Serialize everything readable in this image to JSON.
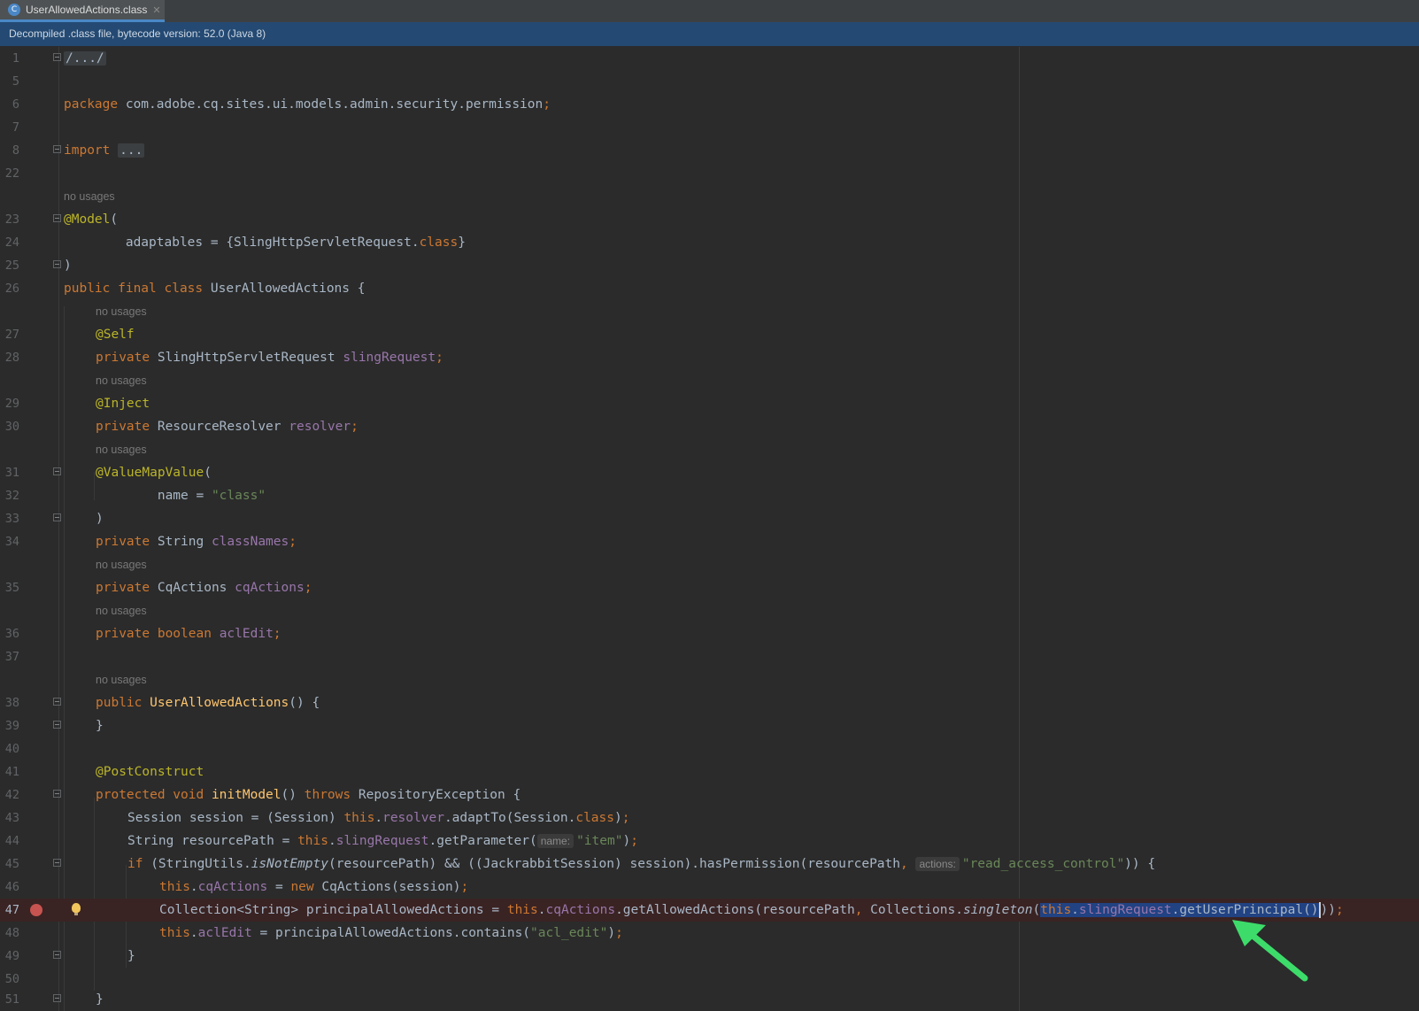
{
  "tab": {
    "title": "UserAllowedActions.class",
    "icon": "class-file-icon",
    "close_icon": "close-icon"
  },
  "banner": {
    "text": "Decompiled .class file, bytecode version: 52.0 (Java 8)"
  },
  "hints": {
    "no_usages": "no usages",
    "name": "name:",
    "actions": "actions:"
  },
  "lines": {
    "1": "1",
    "5": "5",
    "6": "6",
    "7": "7",
    "8": "8",
    "22": "22",
    "23": "23",
    "24": "24",
    "25": "25",
    "26": "26",
    "27": "27",
    "28": "28",
    "29": "29",
    "30": "30",
    "31": "31",
    "32": "32",
    "33": "33",
    "34": "34",
    "35": "35",
    "36": "36",
    "37": "37",
    "38": "38",
    "39": "39",
    "40": "40",
    "41": "41",
    "42": "42",
    "43": "43",
    "44": "44",
    "45": "45",
    "46": "46",
    "47": "47",
    "48": "48",
    "49": "49",
    "50": "50",
    "51": "51"
  },
  "code": {
    "l1": "/.../",
    "l6": {
      "kw": "package",
      "rest": " com.adobe.cq.sites.ui.models.admin.security.permission",
      "semi": ";"
    },
    "l8": {
      "kw": "import",
      "folded": "..."
    },
    "l23": {
      "ann": "@Model",
      "rest": "("
    },
    "l24": {
      "pre": "        adaptables = {SlingHttpServletRequest.",
      "kw": "class",
      "post": "}"
    },
    "l25": ")",
    "l26": {
      "kw": "public final class",
      "rest": " UserAllowedActions {"
    },
    "l27": "@Self",
    "l28": {
      "kw": "private",
      "type": " SlingHttpServletRequest ",
      "field": "slingRequest",
      "semi": ";"
    },
    "l29": "@Inject",
    "l30": {
      "kw": "private",
      "type": " ResourceResolver ",
      "field": "resolver",
      "semi": ";"
    },
    "l31": {
      "ann": "@ValueMapValue",
      "rest": "("
    },
    "l32": {
      "pre": "        name = ",
      "str": "\"class\""
    },
    "l33": ")",
    "l34": {
      "kw": "private",
      "type": " String ",
      "field": "classNames",
      "semi": ";"
    },
    "l35": {
      "kw": "private",
      "type": " CqActions ",
      "field": "cqActions",
      "semi": ";"
    },
    "l36": {
      "kw": "private boolean",
      "type": " ",
      "field": "aclEdit",
      "semi": ";"
    },
    "l38": {
      "kw": "public",
      "fn": "UserAllowedActions",
      "rest": "() {"
    },
    "l39": "}",
    "l41": "@PostConstruct",
    "l42": {
      "kw1": "protected void",
      "fn": "initModel",
      "mid": "() ",
      "kw2": "throws",
      "rest": " RepositoryException {"
    },
    "l43": {
      "pre": "Session session = (Session) ",
      "this": "this",
      "dot": ".",
      "field": "resolver",
      "mid": ".adaptTo(Session.",
      "kw": "class",
      "post": ")",
      "semi": ";"
    },
    "l44": {
      "pre": "String resourcePath = ",
      "this": "this",
      "dot": ".",
      "field": "slingRequest",
      "mid": ".getParameter(",
      "str": "\"item\"",
      "post": ")",
      "semi": ";"
    },
    "l45": {
      "kw": "if",
      "a": " (StringUtils.",
      "it": "isNotEmpty",
      "b": "(resourcePath) && ((JackrabbitSession) session).hasPermission(resourcePath",
      "comma": ", ",
      "str": "\"read_access_control\"",
      "post": ")) {"
    },
    "l46": {
      "this": "this",
      "dot": ".",
      "field": "cqActions",
      "mid": " = ",
      "kw": "new",
      "rest": " CqActions(session)",
      "semi": ";"
    },
    "l47": {
      "pre": "Collection<String> principalAllowedActions = ",
      "this": "this",
      "dot": ".",
      "field": "cqActions",
      "mid": ".getAllowedActions(resourcePath",
      "comma": ", ",
      "mid2": "Collections.",
      "it": "singleton",
      "open": "(",
      "sel_this": "this",
      "sel_dot": ".",
      "sel_field": "slingRequest",
      "sel_rest": ".getUserPrincipal()",
      "post": "))",
      "semi": ";"
    },
    "l48": {
      "this": "this",
      "dot": ".",
      "field": "aclEdit",
      "mid": " = principalAllowedActions.contains(",
      "str": "\"acl_edit\"",
      "post": ")",
      "semi": ";"
    },
    "l49": "}",
    "l51": "}"
  },
  "colors": {
    "keyword": "#cc7832",
    "annotation": "#bbb529",
    "field": "#9876aa",
    "string": "#6a8759",
    "method": "#ffc66d",
    "text": "#a9b7c6",
    "selection": "#214283",
    "arrow": "#3ddc6a"
  },
  "icons": {
    "breakpoint": "breakpoint-icon",
    "intention": "lightbulb-icon",
    "arrow": "green-arrow-annotation"
  }
}
